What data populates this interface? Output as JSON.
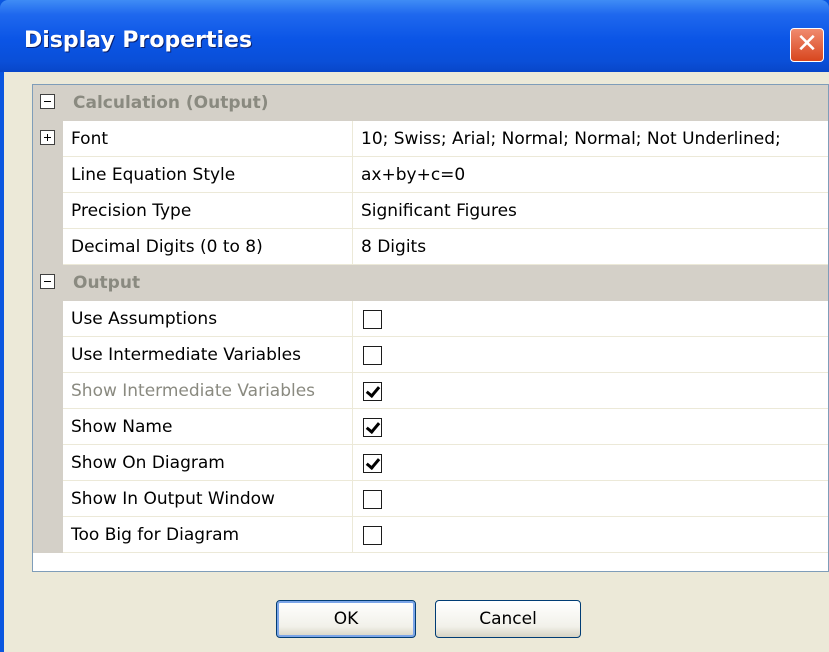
{
  "window": {
    "title": "Display Properties",
    "close_glyph": "✕"
  },
  "grid": {
    "categories": [
      {
        "label": "Calculation (Output)",
        "expanded": true
      },
      {
        "label": "Output",
        "expanded": true
      }
    ],
    "calc_rows": [
      {
        "name": "Font",
        "value": "10; Swiss; Arial; Normal; Normal; Not Underlined;",
        "expandable": true
      },
      {
        "name": "Line Equation Style",
        "value": "ax+by+c=0"
      },
      {
        "name": "Precision Type",
        "value": "Significant Figures"
      },
      {
        "name": "Decimal Digits (0 to 8)",
        "value": "8 Digits"
      }
    ],
    "output_rows": [
      {
        "name": "Use Assumptions",
        "checked": false,
        "enabled": true
      },
      {
        "name": "Use Intermediate Variables",
        "checked": false,
        "enabled": true
      },
      {
        "name": "Show Intermediate Variables",
        "checked": true,
        "enabled": false
      },
      {
        "name": "Show Name",
        "checked": true,
        "enabled": true
      },
      {
        "name": "Show On Diagram",
        "checked": true,
        "enabled": true
      },
      {
        "name": "Show In Output Window",
        "checked": false,
        "enabled": true
      },
      {
        "name": "Too Big for Diagram",
        "checked": false,
        "enabled": true
      }
    ]
  },
  "buttons": {
    "ok_label": "OK",
    "cancel_label": "Cancel"
  },
  "colors": {
    "titlebar": "#0a55e6",
    "dialog_face": "#ece9d8",
    "category_band": "#d4d0c8",
    "disabled_text": "#8a8a80"
  }
}
